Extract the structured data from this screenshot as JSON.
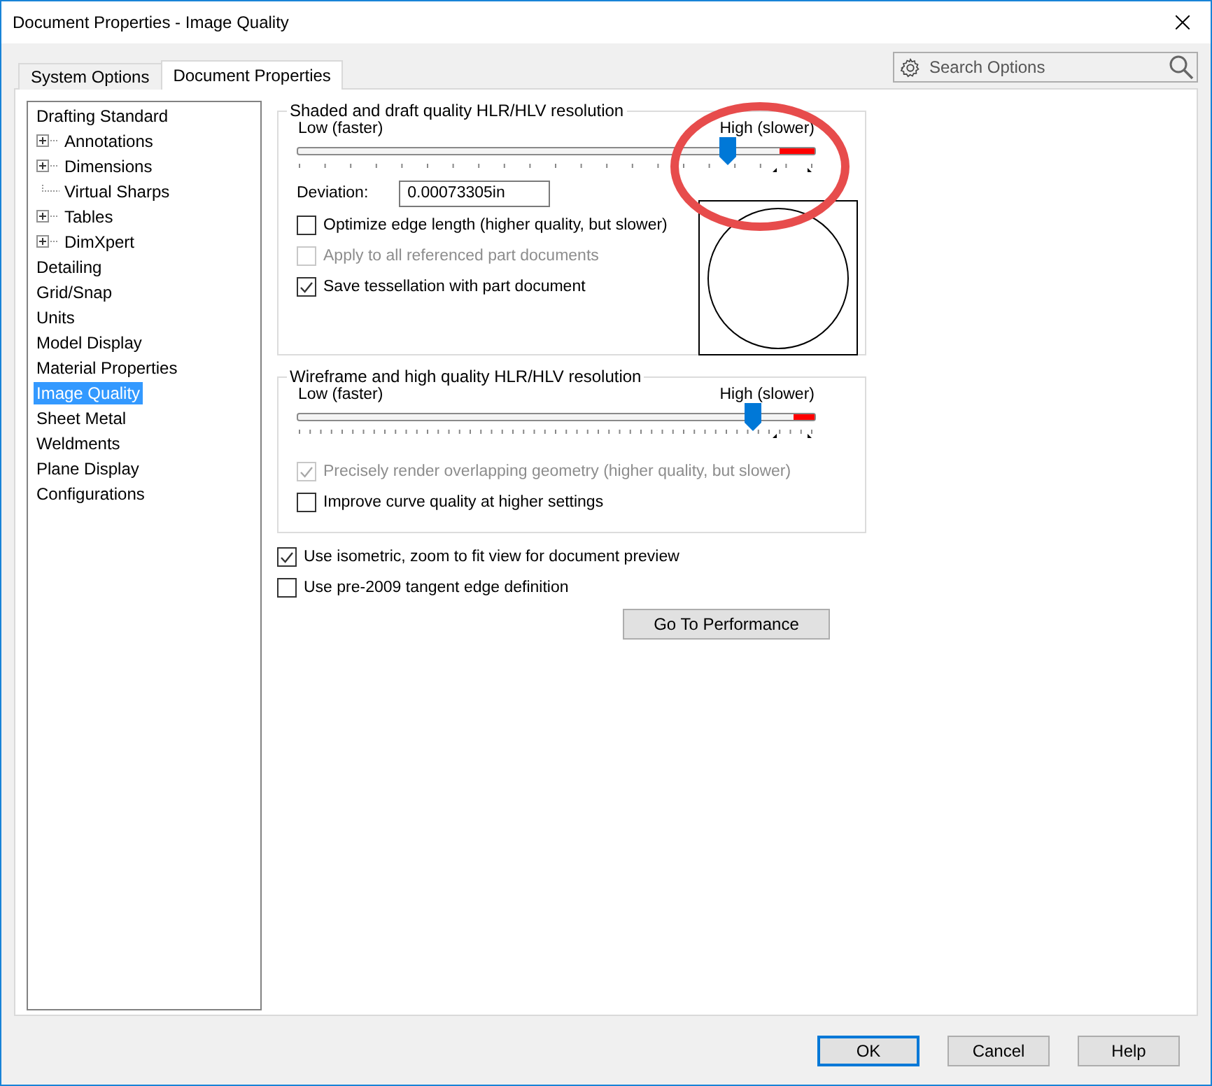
{
  "window": {
    "title": "Document Properties - Image Quality"
  },
  "tabs": [
    {
      "label": "System Options",
      "selected": false
    },
    {
      "label": "Document Properties",
      "selected": true
    }
  ],
  "search": {
    "placeholder": "Search Options"
  },
  "tree": [
    {
      "label": "Drafting Standard",
      "selected": false,
      "children": [
        {
          "label": "Annotations",
          "kind": "node",
          "selected": false
        },
        {
          "label": "Dimensions",
          "kind": "node",
          "selected": false
        },
        {
          "label": "Virtual Sharps",
          "kind": "leaf",
          "selected": false
        },
        {
          "label": "Tables",
          "kind": "node",
          "selected": false
        },
        {
          "label": "DimXpert",
          "kind": "node",
          "selected": false
        }
      ]
    },
    {
      "label": "Detailing",
      "selected": false
    },
    {
      "label": "Grid/Snap",
      "selected": false
    },
    {
      "label": "Units",
      "selected": false
    },
    {
      "label": "Model Display",
      "selected": false
    },
    {
      "label": "Material Properties",
      "selected": false
    },
    {
      "label": "Image Quality",
      "selected": true
    },
    {
      "label": "Sheet Metal",
      "selected": false
    },
    {
      "label": "Weldments",
      "selected": false
    },
    {
      "label": "Plane Display",
      "selected": false
    },
    {
      "label": "Configurations",
      "selected": false
    }
  ],
  "shaded_group": {
    "title": "Shaded and draft quality HLR/HLV resolution",
    "low_label": "Low (faster)",
    "high_label": "High (slower)",
    "level": 0.83,
    "deviation_label": "Deviation:",
    "deviation_value": "0.00073305in",
    "options": [
      {
        "label": "Optimize edge length (higher quality, but slower)",
        "checked": false,
        "disabled": false
      },
      {
        "label": "Apply to all referenced part documents",
        "checked": false,
        "disabled": true
      },
      {
        "label": "Save tessellation with part document",
        "checked": true,
        "disabled": false
      }
    ]
  },
  "wireframe_group": {
    "title": "Wireframe and high quality HLR/HLV resolution",
    "low_label": "Low (faster)",
    "high_label": "High (slower)",
    "level": 0.88,
    "options": [
      {
        "label": "Precisely render overlapping geometry (higher quality, but slower)",
        "checked": true,
        "disabled": true
      },
      {
        "label": "Improve curve quality at higher settings",
        "checked": false,
        "disabled": false
      }
    ]
  },
  "options": [
    {
      "label": "Use isometric, zoom to fit view for document preview",
      "checked": true,
      "disabled": false
    },
    {
      "label": "Use pre-2009 tangent edge definition",
      "checked": false,
      "disabled": false
    }
  ],
  "performance_button": "Go To Performance",
  "buttons": [
    {
      "label": "OK",
      "default": true
    },
    {
      "label": "Cancel",
      "default": false
    },
    {
      "label": "Help",
      "default": false
    }
  ]
}
